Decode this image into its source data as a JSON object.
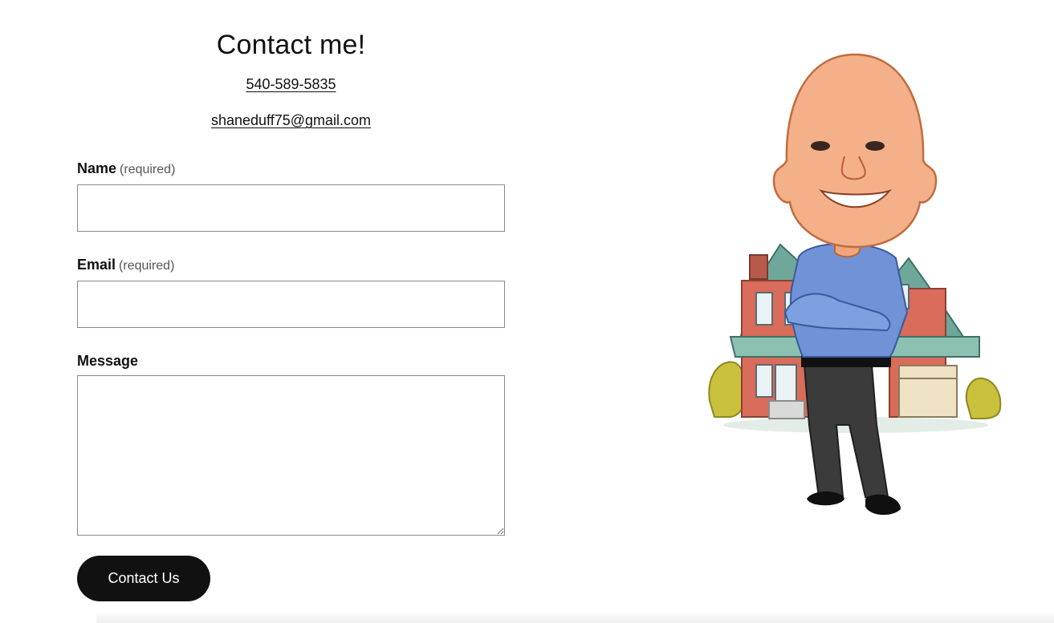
{
  "contact": {
    "title": "Contact me!",
    "phone": "540-589-5835",
    "email": "shaneduff75@gmail.com"
  },
  "form": {
    "name_label": "Name",
    "name_required": "(required)",
    "email_label": "Email",
    "email_required": "(required)",
    "message_label": "Message",
    "name_value": "",
    "email_value": "",
    "message_value": "",
    "submit_label": "Contact Us"
  },
  "illustration": {
    "icon": "agent-caricature-with-house-illustration"
  },
  "colors": {
    "text": "#111111",
    "button_bg": "#111111",
    "button_text": "#ffffff",
    "input_border": "#8a8a8a"
  }
}
